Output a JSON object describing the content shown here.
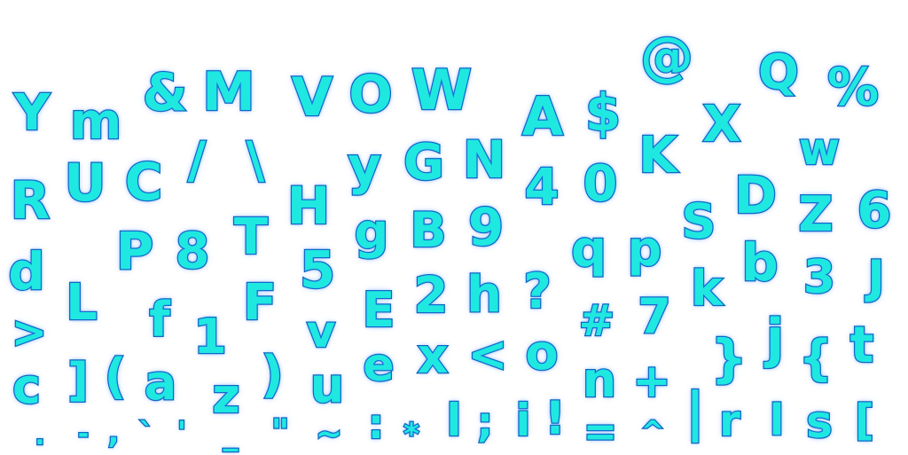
{
  "theme": {
    "fill": "#1fe8e0",
    "outline": "#0a63b8",
    "background": "#ffffff"
  },
  "glyphs": [
    "Y",
    "m",
    "&",
    "M",
    "V",
    "O",
    "W",
    "A",
    "$",
    "@",
    "X",
    "Q",
    "%",
    "R",
    "U",
    "C",
    "/",
    "\\",
    "y",
    "G",
    "N",
    "4",
    "0",
    "K",
    "w",
    "H",
    "D",
    "Z",
    "6",
    "P",
    "8",
    "T",
    "g",
    "B",
    "9",
    "S",
    "q",
    "p",
    "d",
    "5",
    "b",
    "3",
    "J",
    "L",
    "F",
    "E",
    "2",
    "h",
    "?",
    "k",
    ">",
    "f",
    "1",
    "v",
    "#",
    "7",
    "j",
    "{",
    "t",
    "c",
    "]",
    "(",
    "a",
    "z",
    ")",
    "u",
    "e",
    "x",
    "<",
    "o",
    "}",
    "n",
    "+",
    ".",
    "-",
    ",",
    "`",
    "'",
    "_",
    "\"",
    "~",
    ":",
    "*",
    "l",
    ";",
    "i",
    "!",
    "=",
    "^",
    "|",
    "r",
    "l",
    "s",
    "["
  ]
}
